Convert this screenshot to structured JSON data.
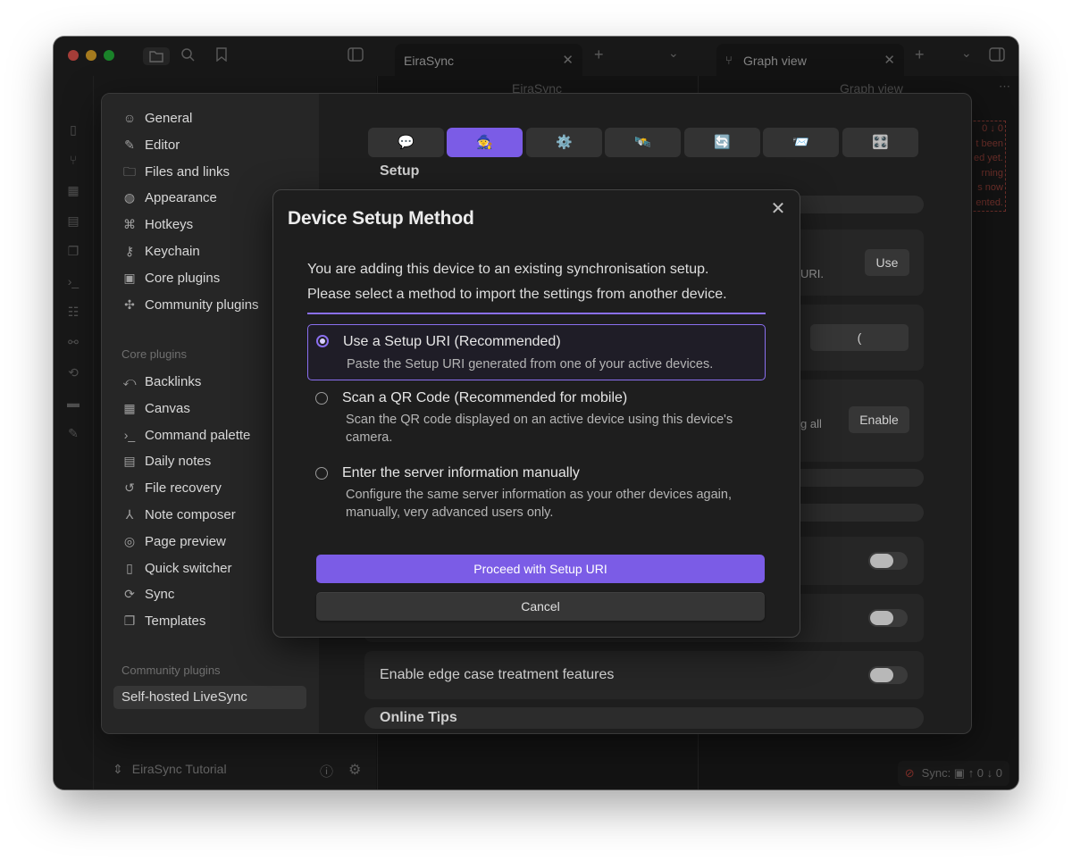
{
  "tabs": [
    {
      "label": "EiraSync"
    },
    {
      "label": "Graph view"
    }
  ],
  "panes": {
    "center_title": "EiraSync",
    "right_title": "Graph view",
    "vault_name": "EiraSync Tutorial",
    "status_sync": "Sync: ▣ ↑ 0 ↓ 0",
    "error_snippet": "0 ↓ 0\nt been\ned yet.\nrning\ns now\nented."
  },
  "settings": {
    "options_nav": [
      {
        "label": "General",
        "icon": "user-circle-icon"
      },
      {
        "label": "Editor",
        "icon": "pencil-icon"
      },
      {
        "label": "Files and links",
        "icon": "folder-link-icon"
      },
      {
        "label": "Appearance",
        "icon": "palette-icon"
      },
      {
        "label": "Hotkeys",
        "icon": "command-icon"
      },
      {
        "label": "Keychain",
        "icon": "key-icon"
      },
      {
        "label": "Core plugins",
        "icon": "plug-box-icon"
      },
      {
        "label": "Community plugins",
        "icon": "puzzle-icon"
      }
    ],
    "core_heading": "Core plugins",
    "core_plugins": [
      {
        "label": "Backlinks",
        "icon": "backlink-icon"
      },
      {
        "label": "Canvas",
        "icon": "canvas-icon"
      },
      {
        "label": "Command palette",
        "icon": "terminal-icon"
      },
      {
        "label": "Daily notes",
        "icon": "calendar-icon"
      },
      {
        "label": "File recovery",
        "icon": "history-icon"
      },
      {
        "label": "Note composer",
        "icon": "merge-icon"
      },
      {
        "label": "Page preview",
        "icon": "eye-scan-icon"
      },
      {
        "label": "Quick switcher",
        "icon": "file-search-icon"
      },
      {
        "label": "Sync",
        "icon": "refresh-icon"
      },
      {
        "label": "Templates",
        "icon": "copy-icon"
      }
    ],
    "community_heading": "Community plugins",
    "community_plugins": [
      {
        "label": "Self-hosted LiveSync"
      }
    ],
    "setup_section": "Setup",
    "use_button": "Use",
    "uri_fragment": "URI.",
    "paren_button": "(",
    "enable_fragment": "g all",
    "enable_button": "Enable",
    "edge_case_label": "Enable edge case treatment features",
    "online_tips": "Online Tips"
  },
  "dialog": {
    "title": "Device Setup Method",
    "desc_line1": "You are adding this device to an existing synchronisation setup.",
    "desc_line2": "Please select a method to import the settings from another device.",
    "options": [
      {
        "title": "Use a Setup URI (Recommended)",
        "description": "Paste the Setup URI generated from one of your active devices.",
        "selected": true
      },
      {
        "title": "Scan a QR Code (Recommended for mobile)",
        "description": "Scan the QR code displayed on an active device using this device's camera.",
        "selected": false
      },
      {
        "title": "Enter the server information manually",
        "description": "Configure the same server information as your other devices again, manually, very advanced users only.",
        "selected": false
      }
    ],
    "proceed_label": "Proceed with Setup URI",
    "cancel_label": "Cancel"
  },
  "colors": {
    "accent": "#7b5ce6",
    "background": "#1e1e1e"
  }
}
